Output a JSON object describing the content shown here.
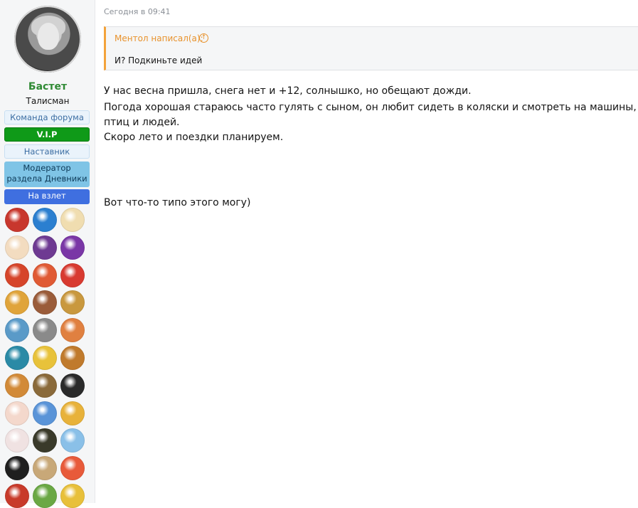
{
  "sidebar": {
    "username": "Бастет",
    "user_title": "Талисман",
    "badges": {
      "team": "Команда форума",
      "vip": "V.I.P",
      "mentor": "Наставник",
      "moderator": "Модератор раздела Дневники",
      "flight": "На взлет"
    },
    "awards": [
      {
        "icon": "reading-book-icon",
        "color": "#c8372d"
      },
      {
        "icon": "blue-profile-icon",
        "color": "#2b7fd0"
      },
      {
        "icon": "chef-cartoon-icon",
        "color": "#f0ddb0"
      },
      {
        "icon": "bird-branch-icon",
        "color": "#f3dcc0"
      },
      {
        "icon": "purple-figure-icon",
        "color": "#6e3a92"
      },
      {
        "icon": "purple-silhouette-icon",
        "color": "#7a36a6"
      },
      {
        "icon": "red-lion-icon",
        "color": "#d6452a"
      },
      {
        "icon": "red-woman-icon",
        "color": "#e05a34"
      },
      {
        "icon": "santa-claus-icon",
        "color": "#d83a30"
      },
      {
        "icon": "golden-cat-icon",
        "color": "#e0a43a"
      },
      {
        "icon": "suitcase-icon",
        "color": "#9a5c3a"
      },
      {
        "icon": "robot-icon",
        "color": "#c9983e"
      },
      {
        "icon": "world-map-icon",
        "color": "#5a9ac8"
      },
      {
        "icon": "feather-quill-icon",
        "color": "#8a8a8a"
      },
      {
        "icon": "mountain-sunset-icon",
        "color": "#e08040"
      },
      {
        "icon": "mountain-peak-icon",
        "color": "#2a8aa6"
      },
      {
        "icon": "gold-medal-icon",
        "color": "#e8c23a"
      },
      {
        "icon": "treasure-chest-icon",
        "color": "#c07a2c"
      },
      {
        "icon": "sailing-ship-icon",
        "color": "#d28a38"
      },
      {
        "icon": "brown-stars-icon",
        "color": "#8a6a3a"
      },
      {
        "icon": "film-clapper-icon",
        "color": "#2a2a2a"
      },
      {
        "icon": "ballerina-icon",
        "color": "#f4d8cc"
      },
      {
        "icon": "airplane-icon",
        "color": "#5a94d8"
      },
      {
        "icon": "gold-emblem-icon",
        "color": "#e8b23a"
      },
      {
        "icon": "gymnast-icon",
        "color": "#f0e2e2"
      },
      {
        "icon": "dark-creature-icon",
        "color": "#3a3a2a"
      },
      {
        "icon": "winter-landscape-icon",
        "color": "#8ac0e8"
      },
      {
        "icon": "black-cat-icon",
        "color": "#1f1f1f"
      },
      {
        "icon": "theater-building-icon",
        "color": "#c8a878"
      },
      {
        "icon": "colorful-flower-icon",
        "color": "#e85a3a"
      },
      {
        "icon": "red-badge-icon",
        "color": "#c83a2a"
      },
      {
        "icon": "landscape-icon",
        "color": "#6aa844"
      },
      {
        "icon": "golden-coin-icon",
        "color": "#e8c03a"
      }
    ]
  },
  "post": {
    "timestamp": "Сегодня в 09:41",
    "quote": {
      "author": "Ментол написал(а):",
      "text": "И? Подкиньте идей"
    },
    "lines": [
      "У нас весна пришла, снега нет и +12, солнышко, но обещают дожди.",
      "Погода хорошая стараюсь часто гулять с сыном, он любит сидеть в коляски и смотреть на машины,",
      "птиц и людей.",
      "Скоро лето и поездки планируем.",
      "Вот что-то типо этого могу)"
    ]
  }
}
